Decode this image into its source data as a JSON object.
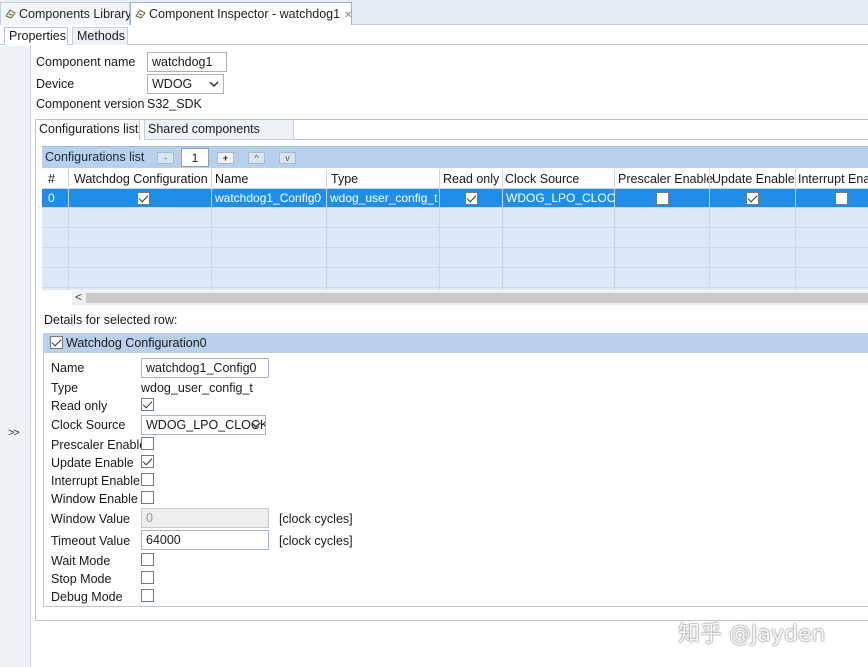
{
  "view_tabs": {
    "library_label": "Components Library",
    "inspector_label": "Component Inspector - watchdog1",
    "close_glyph": "✕"
  },
  "sub_tabs": {
    "properties": "Properties",
    "methods": "Methods"
  },
  "side_strip": {
    "expand_glyph": ">>"
  },
  "component": {
    "name_label": "Component name",
    "name_value": "watchdog1",
    "device_label": "Device",
    "device_value": "WDOG",
    "version_label": "Component version",
    "version_value": "S32_SDK"
  },
  "config_tabs": {
    "list": "Configurations list",
    "shared": "Shared components"
  },
  "config_list": {
    "title": "Configurations list",
    "remove_btn": "-",
    "count": "1",
    "add_btn": "+",
    "up_btn": "^",
    "down_btn": "v",
    "columns": [
      "#",
      "Watchdog Configuration",
      "Name",
      "Type",
      "Read only",
      "Clock Source",
      "Prescaler Enable",
      "Update Enable",
      "Interrupt Enab"
    ],
    "rows": [
      {
        "index": "0",
        "watchdog_configuration": true,
        "name": "watchdog1_Config0",
        "type": "wdog_user_config_t",
        "read_only": true,
        "clock_source": "WDOG_LPO_CLOCK",
        "prescaler_enable": false,
        "update_enable": true,
        "interrupt_enable": false
      }
    ],
    "scroll_left_glyph": "<"
  },
  "details": {
    "section_label": "Details for selected row:",
    "header_title": "Watchdog Configuration0",
    "header_checked": true,
    "name_label": "Name",
    "name_value": "watchdog1_Config0",
    "type_label": "Type",
    "type_value": "wdog_user_config_t",
    "read_only_label": "Read only",
    "read_only": true,
    "clock_source_label": "Clock Source",
    "clock_source_value": "WDOG_LPO_CLOCK",
    "prescaler_label": "Prescaler Enable",
    "prescaler": false,
    "update_label": "Update Enable",
    "update": true,
    "interrupt_label": "Interrupt Enable",
    "interrupt": false,
    "window_enable_label": "Window Enable",
    "window_enable": false,
    "window_value_label": "Window Value",
    "window_value": "0",
    "window_unit": "[clock cycles]",
    "timeout_label": "Timeout Value",
    "timeout_value": "64000",
    "timeout_unit": "[clock cycles]",
    "wait_label": "Wait Mode",
    "wait": false,
    "stop_label": "Stop Mode",
    "stop": false,
    "debug_label": "Debug Mode",
    "debug": false
  },
  "watermark": "知乎 @Jayden",
  "colors": {
    "selection": "#1e8ee8",
    "header_bar": "#b8d0ec",
    "grid_bg": "#dfe9f6"
  }
}
